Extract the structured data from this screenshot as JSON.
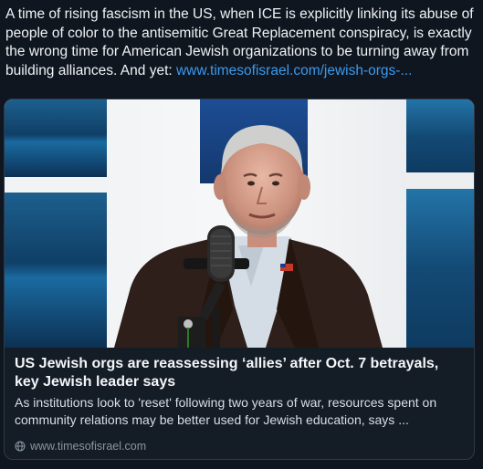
{
  "post": {
    "text": "A time of rising fascism in the US, when ICE is explicitly linking its abuse of people of color to the antisemitic Great Replacement conspiracy, is exactly the wrong time for American Jewish organizations to be turning away from building alliances. And yet: ",
    "link_text": "www.timesofisrael.com/jewish-orgs-..."
  },
  "card": {
    "title": "US Jewish orgs are reassessing ‘allies’ after Oct. 7 betrayals, key Jewish leader says",
    "description": "As institutions look to 'reset' following two years of war, resources spent on community relations may be better used for Jewish education, says ...",
    "domain": "www.timesofisrael.com",
    "domain_icon": "globe-icon"
  },
  "colors": {
    "background": "#0f1620",
    "link": "#3b9aee",
    "card_border": "#2f3a47",
    "muted_text": "#8b96a3"
  }
}
